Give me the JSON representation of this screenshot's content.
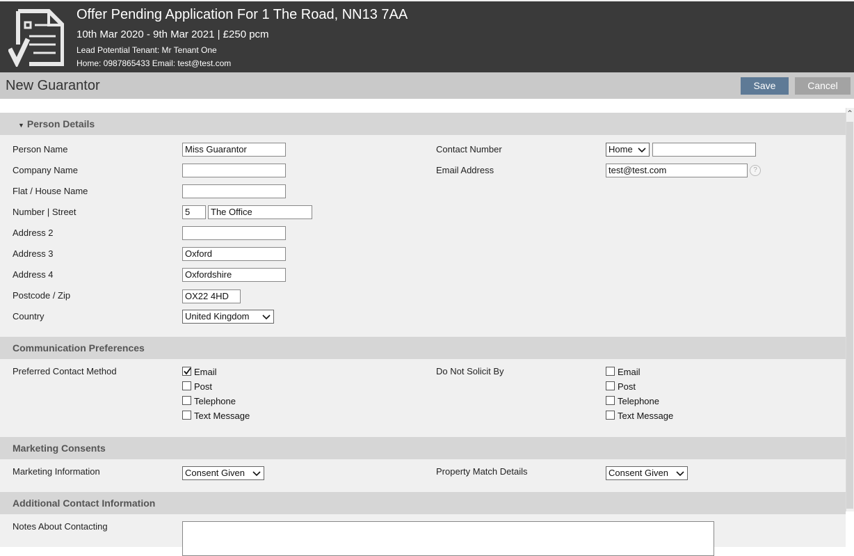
{
  "header": {
    "title": "Offer Pending Application For 1 The Road, NN13 7AA",
    "dates": "10th Mar 2020 - 9th Mar 2021 | £250 pcm",
    "tenant": "Lead Potential Tenant: Mr Tenant One",
    "contact": "Home: 0987865433 Email: test@test.com",
    "icon": "document-check-icon"
  },
  "titlebar": {
    "title": "New Guarantor",
    "save_label": "Save",
    "cancel_label": "Cancel"
  },
  "person": {
    "heading": "Person Details",
    "person_name_label": "Person Name",
    "person_name": "Miss Guarantor",
    "company_label": "Company Name",
    "company": "",
    "flat_label": "Flat / House Name",
    "flat": "",
    "street_label": "Number | Street",
    "number": "5",
    "street": "The Office",
    "addr2_label": "Address 2",
    "addr2": "",
    "addr3_label": "Address 3",
    "addr3": "Oxford",
    "addr4_label": "Address 4",
    "addr4": "Oxfordshire",
    "postcode_label": "Postcode / Zip",
    "postcode": "OX22 4HD",
    "country_label": "Country",
    "country": "United Kingdom",
    "contact_label": "Contact Number",
    "contact_type": "Home",
    "contact_number": "",
    "email_label": "Email Address",
    "email": "test@test.com",
    "help": "?"
  },
  "comm": {
    "heading": "Communication Preferences",
    "preferred_label": "Preferred Contact Method",
    "preferred": [
      {
        "label": "Email",
        "checked": true
      },
      {
        "label": "Post",
        "checked": false
      },
      {
        "label": "Telephone",
        "checked": false
      },
      {
        "label": "Text Message",
        "checked": false
      }
    ],
    "dns_label": "Do Not Solicit By",
    "dns": [
      {
        "label": "Email",
        "checked": false
      },
      {
        "label": "Post",
        "checked": false
      },
      {
        "label": "Telephone",
        "checked": false
      },
      {
        "label": "Text Message",
        "checked": false
      }
    ]
  },
  "marketing": {
    "heading": "Marketing Consents",
    "info_label": "Marketing Information",
    "info_value": "Consent Given",
    "match_label": "Property Match Details",
    "match_value": "Consent Given"
  },
  "additional": {
    "heading": "Additional Contact Information",
    "notes_label": "Notes About Contacting",
    "notes": ""
  }
}
